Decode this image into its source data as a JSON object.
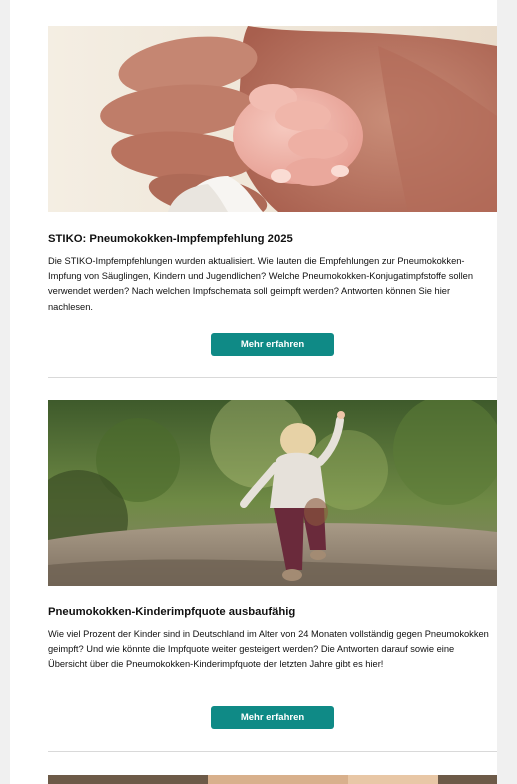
{
  "articles": [
    {
      "image_alt": "Baby hand holding adult hand",
      "title": "STIKO: Pneumokokken-Impfempfehlung 2025",
      "body": "Die STIKO-Impfempfehlungen wurden aktualisiert. Wie lauten die Empfehlungen zur Pneumokokken-Impfung von Säuglingen, Kindern und Jugendlichen? Welche Pneumokokken-Konjugatimpfstoffe sollen verwendet werden? Nach welchen Impfschemata soll geimpft werden? Antworten können Sie hier nachlesen.",
      "cta": "Mehr erfahren"
    },
    {
      "image_alt": "Toddler walking on forest path",
      "title": "Pneumokokken-Kinderimpfquote ausbaufähig",
      "body": "Wie viel Prozent der Kinder sind in Deutschland im Alter von 24 Monaten vollständig gegen Pneumokokken geimpft? Und wie könnte die Impfquote weiter gesteigert werden? Die Antworten darauf sowie eine Übersicht über die Pneumokokken-Kinderimpfquote der letzten Jahre gibt es hier!",
      "cta": "Mehr erfahren"
    }
  ],
  "colors": {
    "accent": "#0f8a86",
    "page_gutter": "#f0f0f0",
    "divider": "#d9d9d9"
  }
}
